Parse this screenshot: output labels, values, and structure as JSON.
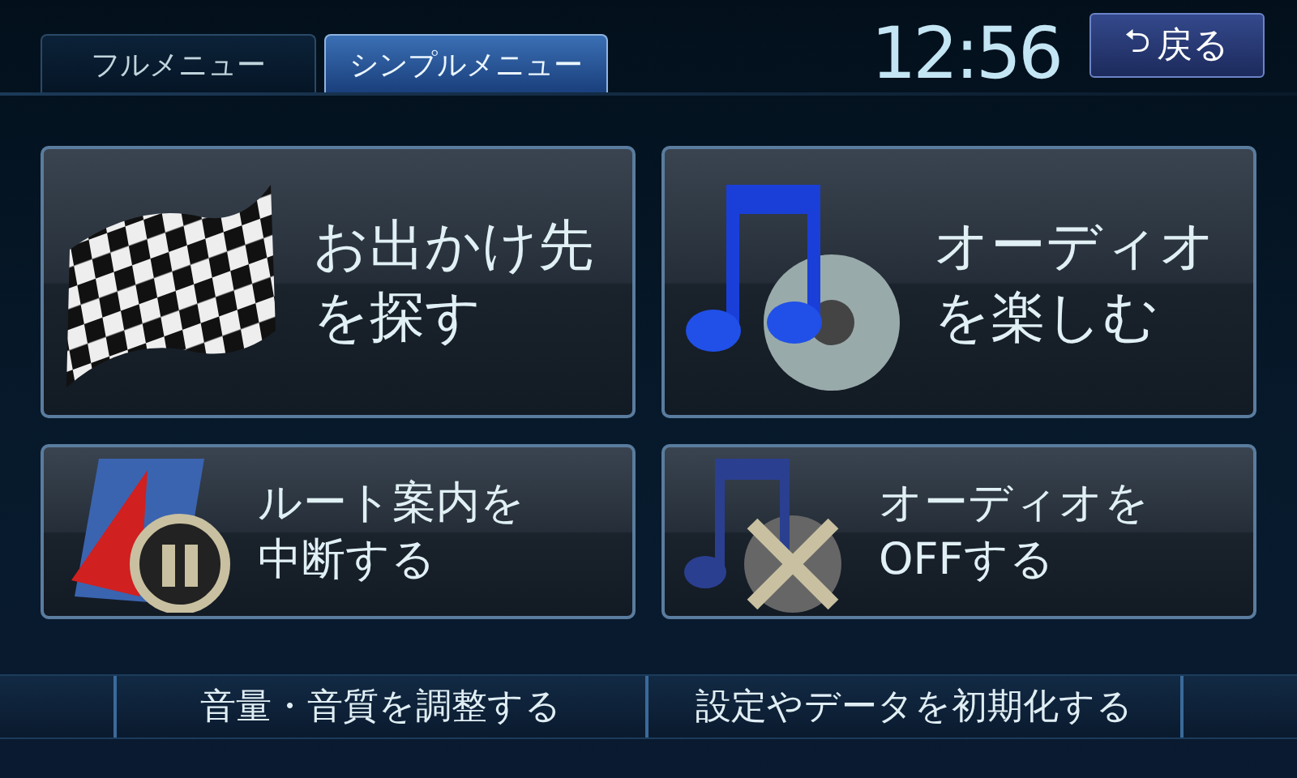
{
  "tabs": [
    {
      "label": "フルメニュー",
      "selected": false
    },
    {
      "label": "シンプルメニュー",
      "selected": true
    }
  ],
  "clock": "12:56",
  "back_button": {
    "icon": "⮌",
    "label": "戻る"
  },
  "tiles": [
    {
      "kind": "flag",
      "label": "お出かけ先を探す"
    },
    {
      "kind": "music",
      "label": "オーディオを楽しむ"
    },
    {
      "kind": "route-pause",
      "label": "ルート案内を中断する"
    },
    {
      "kind": "music-off",
      "label": "オーディオをOFFする"
    }
  ],
  "bottom_buttons": [
    "音量・音質を調整する",
    "設定やデータを初期化する"
  ]
}
